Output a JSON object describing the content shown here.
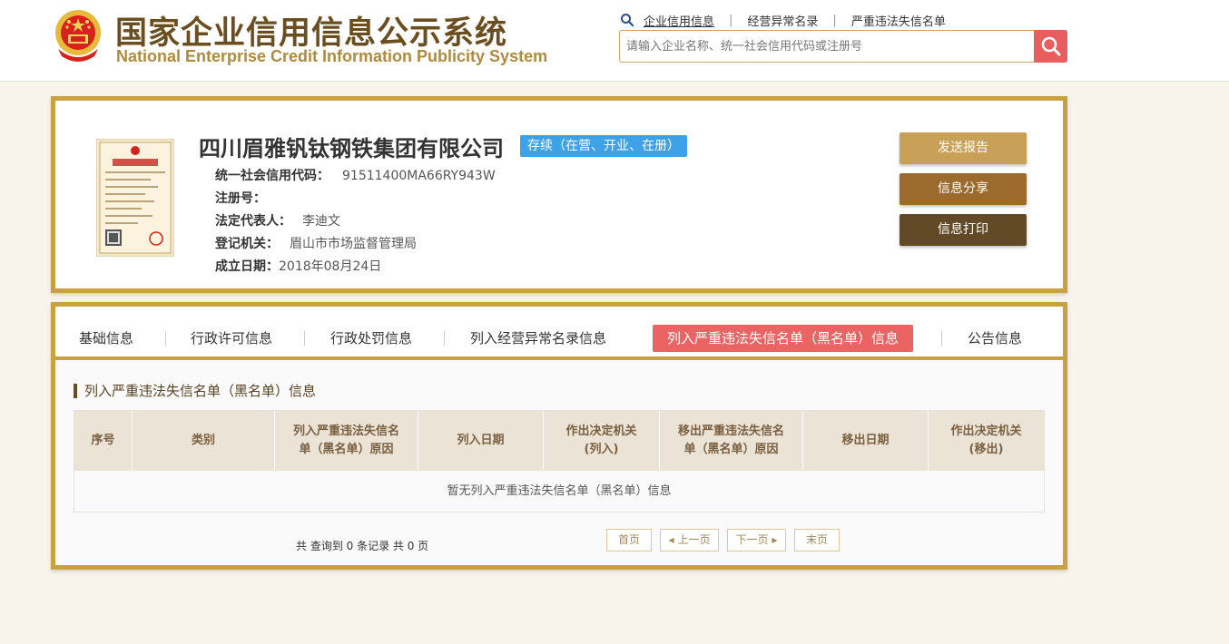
{
  "header": {
    "title_cn": "国家企业信用信息公示系统",
    "title_en": "National Enterprise Credit Information Publicity System",
    "nav": [
      "企业信用信息",
      "经营异常名录",
      "严重违法失信名单"
    ],
    "search_placeholder": "请输入企业名称、统一社会信用代码或注册号"
  },
  "company": {
    "name": "四川眉雅钒钛钢铁集团有限公司",
    "status": "存续（在营、开业、在册）",
    "credit_code_label": "统一社会信用代码：",
    "credit_code": "91511400MA66RY943W",
    "reg_no_label": "注册号：",
    "reg_no": "",
    "legal_rep_label": "法定代表人：",
    "legal_rep": "李迪文",
    "authority_label": "登记机关：",
    "authority": "眉山市市场监督管理局",
    "founded_label": "成立日期：",
    "founded": "2018年08月24日"
  },
  "actions": {
    "send_report": "发送报告",
    "share": "信息分享",
    "print": "信息打印"
  },
  "tabs": [
    "基础信息",
    "行政许可信息",
    "行政处罚信息",
    "列入经营异常名录信息",
    "列入严重违法失信名单（黑名单）信息",
    "公告信息"
  ],
  "section": {
    "title": "列入严重违法失信名单（黑名单）信息",
    "columns": {
      "c1": "序号",
      "c2": "类别",
      "c3a": "列入严重违法失信名",
      "c3b": "单（黑名单）原因",
      "c4": "列入日期",
      "c5a": "作出决定机关",
      "c5b": "(列入)",
      "c6a": "移出严重违法失信名",
      "c6b": "单（黑名单）原因",
      "c7": "移出日期",
      "c8a": "作出决定机关",
      "c8b": "(移出)"
    },
    "empty_message": "暂无列入严重违法失信名单（黑名单）信息"
  },
  "pagination": {
    "summary": "共 查询到 0 条记录 共 0 页",
    "first": "首页",
    "prev": "上一页",
    "next": "下一页",
    "last": "末页"
  },
  "colors": {
    "gold": "#c9a13f",
    "active_tab": "#ea6464",
    "status_badge": "#3ea2e8",
    "btn_send": "#c9a058",
    "btn_share": "#9b6a2c",
    "btn_print": "#634a27"
  }
}
